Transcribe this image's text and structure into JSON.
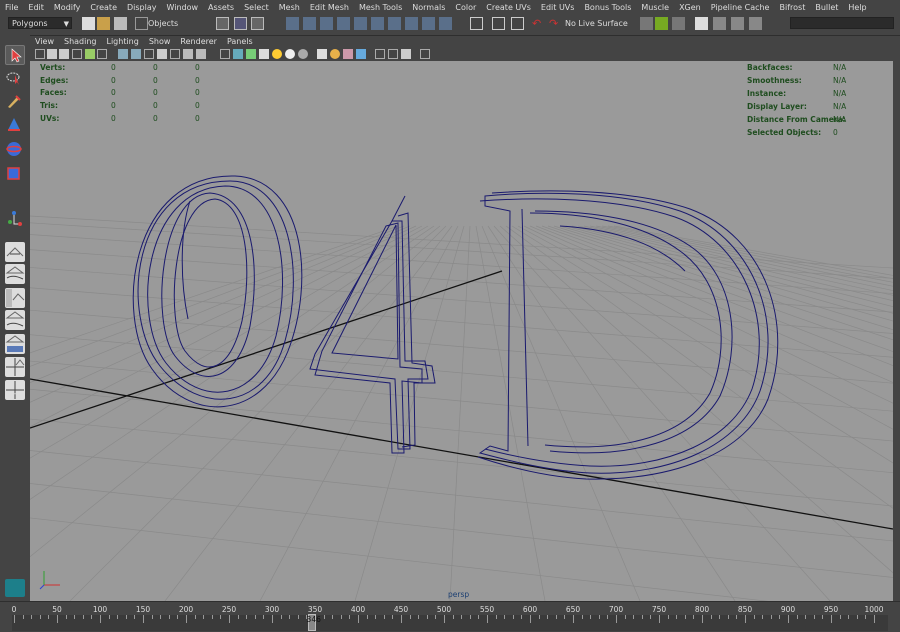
{
  "menu": [
    "File",
    "Edit",
    "Modify",
    "Create",
    "Display",
    "Window",
    "Assets",
    "Select",
    "Mesh",
    "Edit Mesh",
    "Mesh Tools",
    "Normals",
    "Color",
    "Create UVs",
    "Edit UVs",
    "Bonus Tools",
    "Muscle",
    "XGen",
    "Pipeline Cache",
    "Bifrost",
    "Bullet",
    "Help"
  ],
  "status_line": {
    "mode": "Polygons",
    "selection_mode": "Objects",
    "live_surface": "No Live Surface",
    "search_value": ""
  },
  "panel_menu": [
    "View",
    "Shading",
    "Lighting",
    "Show",
    "Renderer",
    "Panels"
  ],
  "hud_left": [
    {
      "label": "Verts:",
      "values": [
        "0",
        "0",
        "0"
      ]
    },
    {
      "label": "Edges:",
      "values": [
        "0",
        "0",
        "0"
      ]
    },
    {
      "label": "Faces:",
      "values": [
        "0",
        "0",
        "0"
      ]
    },
    {
      "label": "Tris:",
      "values": [
        "0",
        "0",
        "0"
      ]
    },
    {
      "label": "UVs:",
      "values": [
        "0",
        "0",
        "0"
      ]
    }
  ],
  "hud_right": [
    {
      "label": "Backfaces:",
      "value": "N/A"
    },
    {
      "label": "Smoothness:",
      "value": "N/A"
    },
    {
      "label": "Instance:",
      "value": "N/A"
    },
    {
      "label": "Display Layer:",
      "value": "N/A"
    },
    {
      "label": "Distance From Camera:",
      "value": "N/A"
    },
    {
      "label": "Selected Objects:",
      "value": "0"
    }
  ],
  "camera_label": "persp",
  "axis_labels": {
    "x": "x",
    "y": "y",
    "z": "z"
  },
  "timeline": {
    "ticks": [
      "0",
      "50",
      "100",
      "150",
      "200",
      "250",
      "300",
      "350",
      "400",
      "450",
      "500",
      "550",
      "600",
      "650",
      "700",
      "750",
      "800",
      "850",
      "900",
      "950",
      "1000"
    ],
    "current_frame": "346"
  },
  "colors": {
    "viewport_bg": "#9a9a9a",
    "curves": "#1a1a6e",
    "hud_text": "#1f4d1f",
    "ui_bg": "#444444"
  }
}
